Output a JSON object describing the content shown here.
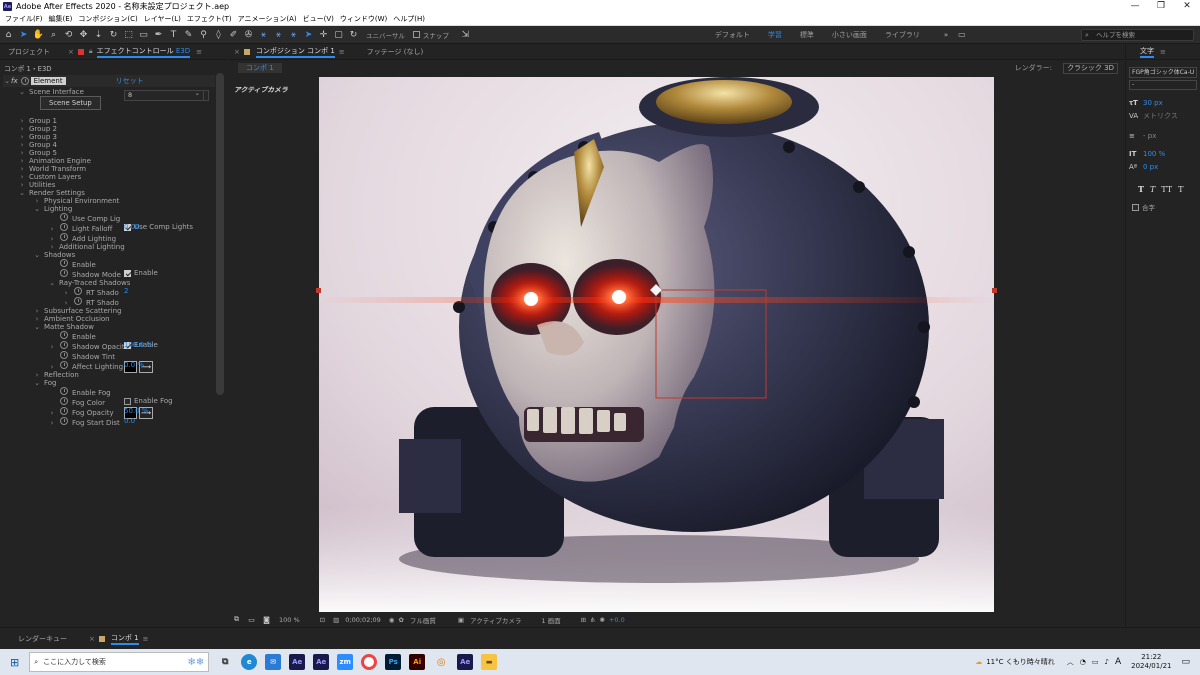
{
  "window": {
    "title": "Adobe After Effects 2020 - 名称未設定プロジェクト.aep",
    "app_badge": "Ae"
  },
  "menu": [
    "ファイル(F)",
    "編集(E)",
    "コンポジション(C)",
    "レイヤー(L)",
    "エフェクト(T)",
    "アニメーション(A)",
    "ビュー(V)",
    "ウィンドウ(W)",
    "ヘルプ(H)"
  ],
  "toolbar": {
    "tools": [
      "home-icon",
      "selection-tool-icon",
      "hand-tool-icon",
      "zoom-tool-icon",
      "orbit-camera-icon",
      "pan-camera-icon",
      "dolly-camera-icon",
      "rotate-tool-icon",
      "pan-behind-icon",
      "rectangle-tool-icon",
      "pen-tool-icon",
      "text-tool-icon",
      "brush-tool-icon",
      "clone-stamp-icon",
      "eraser-icon",
      "roto-brush-icon",
      "puppet-tool-icon"
    ],
    "universal_label": "ユニバーサル",
    "snap_label": "スナップ",
    "workspaces": [
      "デフォルト",
      "学習",
      "標準",
      "小さい画面",
      "ライブラリ"
    ],
    "active_workspace": "学習",
    "search_placeholder": "ヘルプを検索"
  },
  "left_panel": {
    "tabs": [
      "プロジェクト",
      "エフェクトコントロール",
      "E3D"
    ],
    "subtitle": "コンポ 1・E3D",
    "effect_name": "Element",
    "reset_label": "リセット",
    "rows": [
      {
        "indent": 1,
        "chev": "v",
        "label": "Scene Interface"
      },
      {
        "indent": 0,
        "button": "Scene Setup"
      },
      {
        "indent": 1,
        "chev": ">",
        "label": "Group 1"
      },
      {
        "indent": 1,
        "chev": ">",
        "label": "Group 2"
      },
      {
        "indent": 1,
        "chev": ">",
        "label": "Group 3"
      },
      {
        "indent": 1,
        "chev": ">",
        "label": "Group 4"
      },
      {
        "indent": 1,
        "chev": ">",
        "label": "Group 5"
      },
      {
        "indent": 1,
        "chev": ">",
        "label": "Animation Engine"
      },
      {
        "indent": 1,
        "chev": ">",
        "label": "World Transform"
      },
      {
        "indent": 1,
        "chev": ">",
        "label": "Custom Layers"
      },
      {
        "indent": 1,
        "chev": ">",
        "label": "Utilities"
      },
      {
        "indent": 1,
        "chev": "v",
        "label": "Render Settings"
      },
      {
        "indent": 2,
        "chev": ">",
        "label": "Physical Environment"
      },
      {
        "indent": 2,
        "chev": "v",
        "label": "Lighting"
      },
      {
        "indent": 3,
        "sw": true,
        "label": "Use Comp Lig",
        "check": "Use Comp Lights",
        "checked": true
      },
      {
        "indent": 3,
        "chev": ">",
        "sw": true,
        "label": "Light Falloff",
        "value": "0.00"
      },
      {
        "indent": 3,
        "chev": ">",
        "sw": true,
        "label": "Add Lighting",
        "dropdown": "Cinema"
      },
      {
        "indent": 3,
        "chev": ">",
        "label": "Additional Lighting"
      },
      {
        "indent": 2,
        "chev": "v",
        "label": "Shadows"
      },
      {
        "indent": 3,
        "sw": true,
        "label": "Enable",
        "check": "Enable",
        "checked": true
      },
      {
        "indent": 3,
        "sw": true,
        "label": "Shadow Mode",
        "dropdown": "Ray-Traced"
      },
      {
        "indent": 3,
        "chev": "v",
        "label": "Ray-Traced Shadows"
      },
      {
        "indent": 4,
        "chev": ">",
        "sw": true,
        "label": "RT Shado",
        "value": "2"
      },
      {
        "indent": 4,
        "chev": ">",
        "sw": true,
        "label": "RT Shado",
        "dropdown": "8"
      },
      {
        "indent": 2,
        "chev": ">",
        "label": "Subsurface Scattering"
      },
      {
        "indent": 2,
        "chev": ">",
        "label": "Ambient Occlusion"
      },
      {
        "indent": 2,
        "chev": "v",
        "label": "Matte Shadow"
      },
      {
        "indent": 3,
        "sw": true,
        "label": "Enable",
        "check": "Enable",
        "checked": true
      },
      {
        "indent": 3,
        "chev": ">",
        "sw": true,
        "label": "Shadow Opacit",
        "value": "100.0 %"
      },
      {
        "indent": 3,
        "sw": true,
        "label": "Shadow Tint",
        "color": true
      },
      {
        "indent": 3,
        "chev": ">",
        "sw": true,
        "label": "Affect Lighting",
        "value": "0.0 %"
      },
      {
        "indent": 2,
        "chev": ">",
        "label": "Reflection"
      },
      {
        "indent": 2,
        "chev": "v",
        "label": "Fog"
      },
      {
        "indent": 3,
        "sw": true,
        "label": "Enable Fog",
        "check": "Enable Fog",
        "checked": false
      },
      {
        "indent": 3,
        "sw": true,
        "label": "Fog Color",
        "color": true
      },
      {
        "indent": 3,
        "chev": ">",
        "sw": true,
        "label": "Fog Opacity",
        "value": "50.0 %"
      },
      {
        "indent": 3,
        "chev": ">",
        "sw": true,
        "label": "Fog Start Dist",
        "value": "0.0"
      }
    ]
  },
  "composition": {
    "tabs": [
      "コンポジション コンポ 1",
      "フッテージ (なし)"
    ],
    "sub_tab": "コンポ 1",
    "renderer_label": "レンダラー:",
    "renderer_value": "クラシック 3D",
    "camera_label": "アクティブカメラ",
    "footer": {
      "zoom": "100 %",
      "timecode": "0;00;02;09",
      "resolution": "フル画質",
      "view": "アクティブカメラ",
      "layout": "1 画面",
      "exposure": "+0.0"
    }
  },
  "right_panel": {
    "tab": "文字",
    "font": "FGP角ゴシック体Ca-U",
    "style": "-",
    "size": "30 px",
    "tracking_label": "メトリクス",
    "leading": "- px",
    "v_scale": "100 %",
    "baseline": "0 px",
    "styles": [
      "T",
      "T",
      "TT",
      "T"
    ],
    "option": "合字"
  },
  "timeline": {
    "tabs": [
      "レンダーキュー",
      "コンポ 1"
    ]
  },
  "taskbar": {
    "search_placeholder": "ここに入力して検索",
    "apps": [
      "Ae",
      "Ae",
      "zm",
      "Ps",
      "Ai",
      "Ae"
    ],
    "weather": "11°C くもり時々晴れ",
    "time": "21:22",
    "date": "2024/01/21",
    "ime": "A"
  },
  "colors": {
    "accent": "#2d8ceb",
    "panel": "#232323",
    "lens_flare": "#ff3a1a"
  }
}
